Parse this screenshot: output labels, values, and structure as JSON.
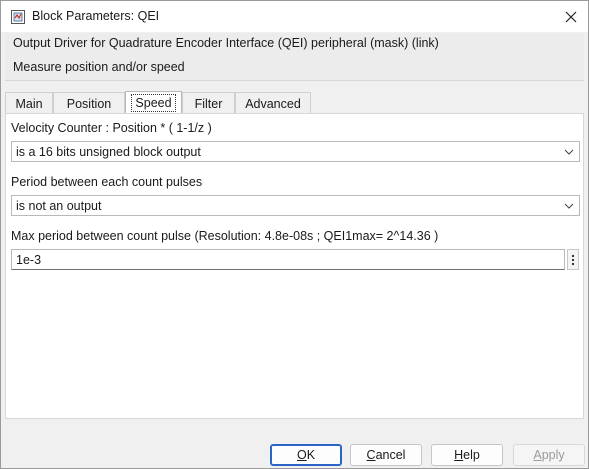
{
  "window": {
    "title": "Block Parameters: QEI"
  },
  "header": {
    "title": "Output Driver for Quadrature Encoder Interface (QEI) peripheral  (mask) (link)",
    "description": "Measure position and/or speed"
  },
  "tabs": [
    {
      "label": "Main"
    },
    {
      "label": "Position"
    },
    {
      "label": "Speed"
    },
    {
      "label": "Filter"
    },
    {
      "label": "Advanced"
    }
  ],
  "active_tab": "Speed",
  "fields": {
    "velocity": {
      "label": "Velocity Counter :  Position * ( 1-1/z )",
      "value": "is a 16 bits unsigned block output"
    },
    "period": {
      "label": "Period between each count pulses",
      "value": "is not an output"
    },
    "max_period": {
      "label": "Max period between count pulse (Resolution: 4.8e-08s  ;  QEI1max=  2^14.36 )",
      "value": "1e-3"
    }
  },
  "buttons": {
    "ok": {
      "first": "O",
      "rest": "K"
    },
    "cancel": {
      "first": "C",
      "rest": "ancel"
    },
    "help": {
      "first": "H",
      "rest": "elp"
    },
    "apply": {
      "first": "A",
      "rest": "pply"
    }
  },
  "icons": {
    "app": "simulink-block-icon",
    "close": "close-icon",
    "dropdown": "chevron-down-icon",
    "more": "vertical-ellipsis-icon"
  },
  "colors": {
    "primary_border": "#2b64c4",
    "panel_bg": "#ffffff",
    "window_bg": "#f0f0f0"
  }
}
